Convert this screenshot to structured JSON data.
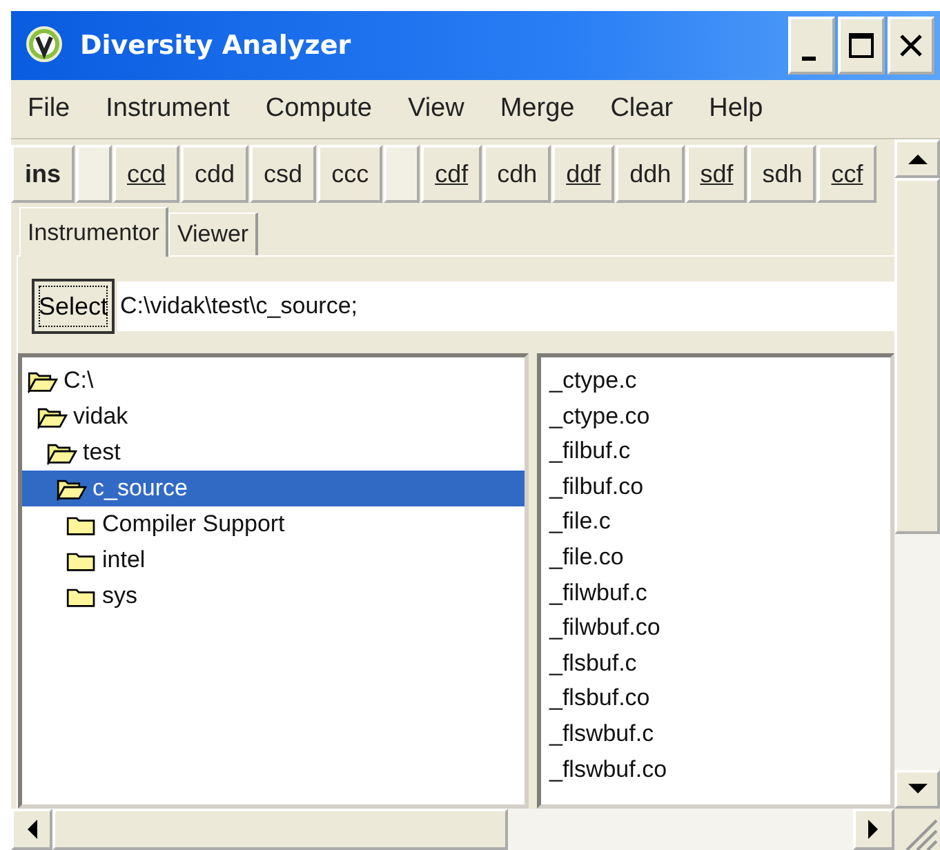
{
  "window": {
    "title": "Diversity Analyzer"
  },
  "menu": [
    "File",
    "Instrument",
    "Compute",
    "View",
    "Merge",
    "Clear",
    "Help"
  ],
  "toolbar": [
    {
      "kind": "bold",
      "label": "ins",
      "underlined": false
    },
    {
      "kind": "spacer"
    },
    {
      "kind": "button",
      "label": "ccd",
      "underlined": true
    },
    {
      "kind": "button",
      "label": "cdd",
      "underlined": false
    },
    {
      "kind": "button",
      "label": "csd",
      "underlined": false
    },
    {
      "kind": "button",
      "label": "ccc",
      "underlined": false
    },
    {
      "kind": "spacer"
    },
    {
      "kind": "button",
      "label": "cdf",
      "underlined": true
    },
    {
      "kind": "button",
      "label": "cdh",
      "underlined": false
    },
    {
      "kind": "button",
      "label": "ddf",
      "underlined": true
    },
    {
      "kind": "button",
      "label": "ddh",
      "underlined": false
    },
    {
      "kind": "button",
      "label": "sdf",
      "underlined": true
    },
    {
      "kind": "button",
      "label": "sdh",
      "underlined": false
    },
    {
      "kind": "button",
      "label": "ccf",
      "underlined": true
    }
  ],
  "tabs": [
    {
      "label": "Instrumentor",
      "selected": true
    },
    {
      "label": "Viewer",
      "selected": false
    }
  ],
  "select_button": "Select",
  "path_field": {
    "value": "C:\\vidak\\test\\c_source;"
  },
  "tree": [
    {
      "label": "C:\\",
      "expanded": true,
      "selected": false,
      "children": [
        {
          "label": "vidak",
          "expanded": true,
          "selected": false,
          "children": [
            {
              "label": "test",
              "expanded": true,
              "selected": false,
              "children": [
                {
                  "label": "c_source",
                  "expanded": true,
                  "selected": true,
                  "children": [
                    {
                      "label": "Compiler Support",
                      "expanded": false,
                      "selected": false
                    },
                    {
                      "label": "intel",
                      "expanded": false,
                      "selected": false
                    },
                    {
                      "label": "sys",
                      "expanded": false,
                      "selected": false
                    }
                  ]
                }
              ]
            }
          ]
        }
      ]
    }
  ],
  "files": [
    "_ctype.c",
    "_ctype.co",
    "_filbuf.c",
    "_filbuf.co",
    "_file.c",
    "_file.co",
    "_filwbuf.c",
    "_filwbuf.co",
    "_flsbuf.c",
    "_flsbuf.co",
    "_flswbuf.c",
    "_flswbuf.co"
  ]
}
